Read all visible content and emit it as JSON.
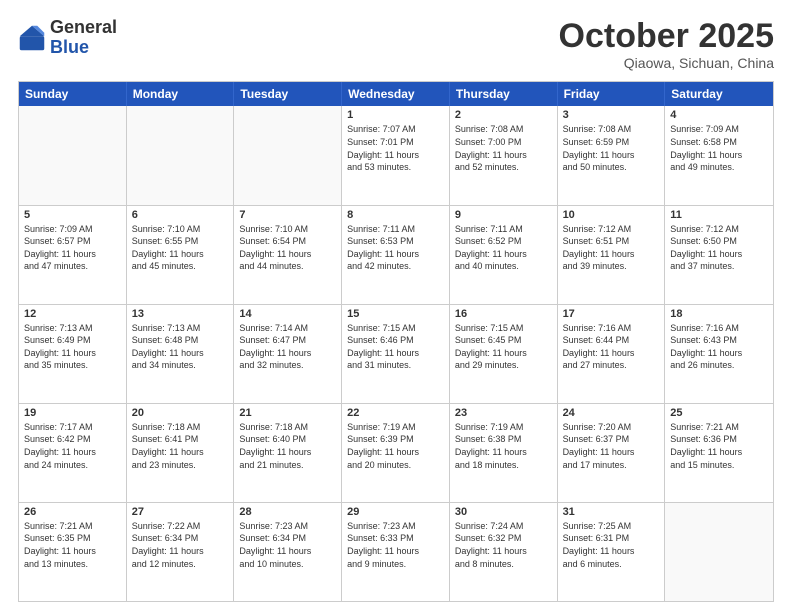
{
  "logo": {
    "general": "General",
    "blue": "Blue"
  },
  "header": {
    "month": "October 2025",
    "location": "Qiaowa, Sichuan, China"
  },
  "days": [
    "Sunday",
    "Monday",
    "Tuesday",
    "Wednesday",
    "Thursday",
    "Friday",
    "Saturday"
  ],
  "weeks": [
    [
      {
        "day": "",
        "info": ""
      },
      {
        "day": "",
        "info": ""
      },
      {
        "day": "",
        "info": ""
      },
      {
        "day": "1",
        "info": "Sunrise: 7:07 AM\nSunset: 7:01 PM\nDaylight: 11 hours\nand 53 minutes."
      },
      {
        "day": "2",
        "info": "Sunrise: 7:08 AM\nSunset: 7:00 PM\nDaylight: 11 hours\nand 52 minutes."
      },
      {
        "day": "3",
        "info": "Sunrise: 7:08 AM\nSunset: 6:59 PM\nDaylight: 11 hours\nand 50 minutes."
      },
      {
        "day": "4",
        "info": "Sunrise: 7:09 AM\nSunset: 6:58 PM\nDaylight: 11 hours\nand 49 minutes."
      }
    ],
    [
      {
        "day": "5",
        "info": "Sunrise: 7:09 AM\nSunset: 6:57 PM\nDaylight: 11 hours\nand 47 minutes."
      },
      {
        "day": "6",
        "info": "Sunrise: 7:10 AM\nSunset: 6:55 PM\nDaylight: 11 hours\nand 45 minutes."
      },
      {
        "day": "7",
        "info": "Sunrise: 7:10 AM\nSunset: 6:54 PM\nDaylight: 11 hours\nand 44 minutes."
      },
      {
        "day": "8",
        "info": "Sunrise: 7:11 AM\nSunset: 6:53 PM\nDaylight: 11 hours\nand 42 minutes."
      },
      {
        "day": "9",
        "info": "Sunrise: 7:11 AM\nSunset: 6:52 PM\nDaylight: 11 hours\nand 40 minutes."
      },
      {
        "day": "10",
        "info": "Sunrise: 7:12 AM\nSunset: 6:51 PM\nDaylight: 11 hours\nand 39 minutes."
      },
      {
        "day": "11",
        "info": "Sunrise: 7:12 AM\nSunset: 6:50 PM\nDaylight: 11 hours\nand 37 minutes."
      }
    ],
    [
      {
        "day": "12",
        "info": "Sunrise: 7:13 AM\nSunset: 6:49 PM\nDaylight: 11 hours\nand 35 minutes."
      },
      {
        "day": "13",
        "info": "Sunrise: 7:13 AM\nSunset: 6:48 PM\nDaylight: 11 hours\nand 34 minutes."
      },
      {
        "day": "14",
        "info": "Sunrise: 7:14 AM\nSunset: 6:47 PM\nDaylight: 11 hours\nand 32 minutes."
      },
      {
        "day": "15",
        "info": "Sunrise: 7:15 AM\nSunset: 6:46 PM\nDaylight: 11 hours\nand 31 minutes."
      },
      {
        "day": "16",
        "info": "Sunrise: 7:15 AM\nSunset: 6:45 PM\nDaylight: 11 hours\nand 29 minutes."
      },
      {
        "day": "17",
        "info": "Sunrise: 7:16 AM\nSunset: 6:44 PM\nDaylight: 11 hours\nand 27 minutes."
      },
      {
        "day": "18",
        "info": "Sunrise: 7:16 AM\nSunset: 6:43 PM\nDaylight: 11 hours\nand 26 minutes."
      }
    ],
    [
      {
        "day": "19",
        "info": "Sunrise: 7:17 AM\nSunset: 6:42 PM\nDaylight: 11 hours\nand 24 minutes."
      },
      {
        "day": "20",
        "info": "Sunrise: 7:18 AM\nSunset: 6:41 PM\nDaylight: 11 hours\nand 23 minutes."
      },
      {
        "day": "21",
        "info": "Sunrise: 7:18 AM\nSunset: 6:40 PM\nDaylight: 11 hours\nand 21 minutes."
      },
      {
        "day": "22",
        "info": "Sunrise: 7:19 AM\nSunset: 6:39 PM\nDaylight: 11 hours\nand 20 minutes."
      },
      {
        "day": "23",
        "info": "Sunrise: 7:19 AM\nSunset: 6:38 PM\nDaylight: 11 hours\nand 18 minutes."
      },
      {
        "day": "24",
        "info": "Sunrise: 7:20 AM\nSunset: 6:37 PM\nDaylight: 11 hours\nand 17 minutes."
      },
      {
        "day": "25",
        "info": "Sunrise: 7:21 AM\nSunset: 6:36 PM\nDaylight: 11 hours\nand 15 minutes."
      }
    ],
    [
      {
        "day": "26",
        "info": "Sunrise: 7:21 AM\nSunset: 6:35 PM\nDaylight: 11 hours\nand 13 minutes."
      },
      {
        "day": "27",
        "info": "Sunrise: 7:22 AM\nSunset: 6:34 PM\nDaylight: 11 hours\nand 12 minutes."
      },
      {
        "day": "28",
        "info": "Sunrise: 7:23 AM\nSunset: 6:34 PM\nDaylight: 11 hours\nand 10 minutes."
      },
      {
        "day": "29",
        "info": "Sunrise: 7:23 AM\nSunset: 6:33 PM\nDaylight: 11 hours\nand 9 minutes."
      },
      {
        "day": "30",
        "info": "Sunrise: 7:24 AM\nSunset: 6:32 PM\nDaylight: 11 hours\nand 8 minutes."
      },
      {
        "day": "31",
        "info": "Sunrise: 7:25 AM\nSunset: 6:31 PM\nDaylight: 11 hours\nand 6 minutes."
      },
      {
        "day": "",
        "info": ""
      }
    ]
  ]
}
